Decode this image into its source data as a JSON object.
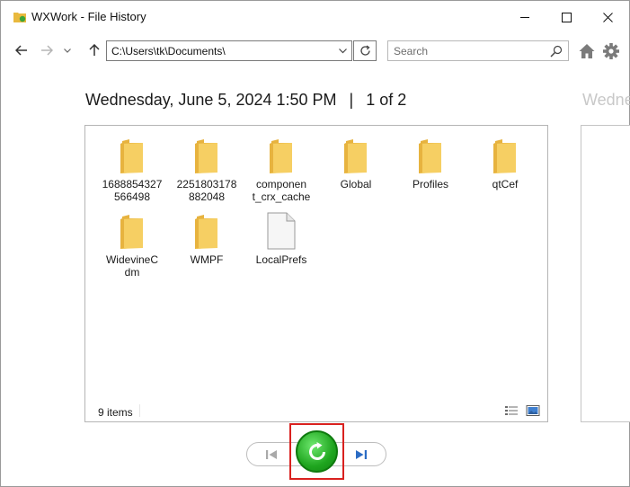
{
  "window": {
    "title": "WXWork - File History",
    "controls": {
      "minimize": "—",
      "maximize": "☐",
      "close": "✕"
    }
  },
  "toolbar": {
    "address": "C:\\Users\\tk\\Documents\\",
    "search_placeholder": "Search"
  },
  "heading": {
    "date": "Wednesday, June 5, 2024 1:50 PM",
    "separator": "|",
    "page": "1 of 2",
    "next_preview": "Wedne"
  },
  "files": [
    {
      "name": "1688854327566498",
      "display": "1688854327\n566498",
      "type": "folder"
    },
    {
      "name": "2251803178882048",
      "display": "2251803178\n882048",
      "type": "folder"
    },
    {
      "name": "component_crx_cache",
      "display": "componen\nt_crx_cache",
      "type": "folder"
    },
    {
      "name": "Global",
      "display": "Global",
      "type": "folder"
    },
    {
      "name": "Profiles",
      "display": "Profiles",
      "type": "folder"
    },
    {
      "name": "qtCef",
      "display": "qtCef",
      "type": "folder"
    },
    {
      "name": "WidevineCdm",
      "display": "WidevineC\ndm",
      "type": "folder"
    },
    {
      "name": "WMPF",
      "display": "WMPF",
      "type": "folder"
    },
    {
      "name": "LocalPrefs",
      "display": "LocalPrefs",
      "type": "file"
    }
  ],
  "status": {
    "item_count": "9 items"
  },
  "colors": {
    "folder": "#f6cf63",
    "folder_dark": "#e7b33f",
    "restore_green": "#1fa51f",
    "highlight_red": "#d9211f",
    "nav_blue": "#2b6cc4"
  },
  "icons": {
    "back": "arrow-left-icon",
    "forward": "arrow-right-icon",
    "recent": "chevron-down-icon",
    "up": "arrow-up-icon",
    "refresh": "refresh-icon",
    "search": "search-icon",
    "home": "home-icon",
    "settings": "gear-icon",
    "restore": "restore-icon",
    "previous": "previous-version-icon",
    "next": "next-version-icon"
  }
}
